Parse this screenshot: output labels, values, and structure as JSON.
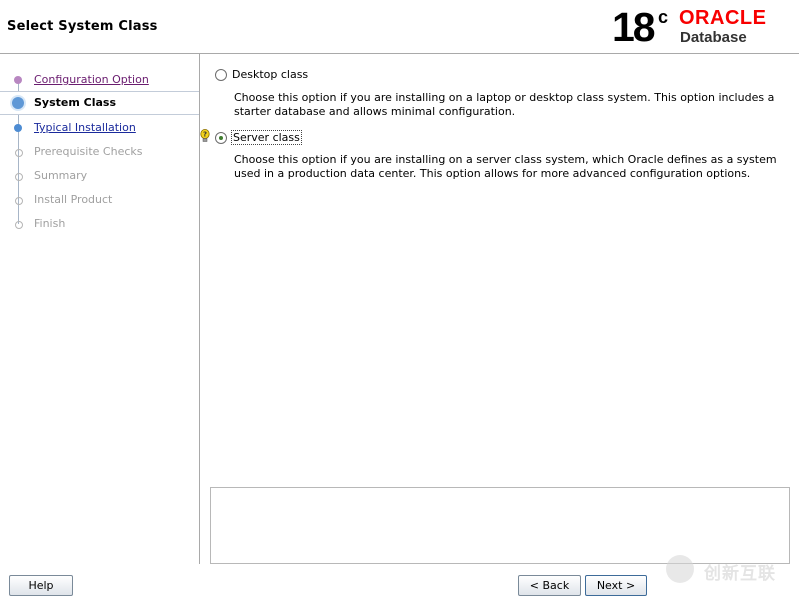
{
  "header": {
    "title": "Select System Class",
    "logo": {
      "version": "18",
      "version_suffix": "c",
      "brand": "ORACLE",
      "product": "Database"
    }
  },
  "sidebar": {
    "steps": [
      {
        "label": "Configuration Option",
        "state": "done"
      },
      {
        "label": "System Class",
        "state": "current"
      },
      {
        "label": "Typical Installation",
        "state": "next"
      },
      {
        "label": "Prerequisite Checks",
        "state": "pending"
      },
      {
        "label": "Summary",
        "state": "pending"
      },
      {
        "label": "Install Product",
        "state": "pending"
      },
      {
        "label": "Finish",
        "state": "pending"
      }
    ]
  },
  "main": {
    "options": [
      {
        "label": "Desktop class",
        "selected": false,
        "description": "Choose this option if you are installing on a laptop or desktop class system. This option includes a starter database and allows minimal configuration."
      },
      {
        "label": "Server class",
        "selected": true,
        "description": "Choose this option if you are installing on a server class system, which Oracle defines as a system used in a production data center. This option allows for more advanced configuration options."
      }
    ],
    "hint_icon": "lightbulb-icon"
  },
  "buttons": {
    "help": "Help",
    "back": "Back",
    "next": "Next >"
  },
  "watermark": {
    "text": "创新互联"
  },
  "colors": {
    "brand_red": "#f80000",
    "done_step": "#6a1c6f",
    "next_step": "#1a2a9c",
    "pending_step": "#a0a0a0"
  }
}
